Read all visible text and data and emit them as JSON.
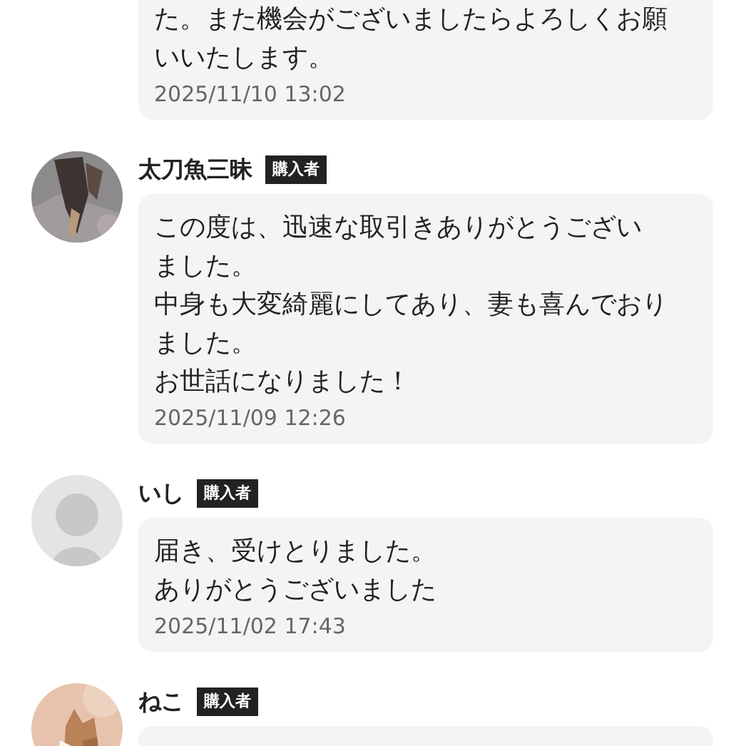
{
  "comments": [
    {
      "lines": [
        "た。また機会がございましたらよろしくお願",
        "いいたします。"
      ],
      "time": "2025/11/10 13:02"
    },
    {
      "name": "太刀魚三昧",
      "badge": "購入者",
      "lines": [
        "この度は、迅速な取引きありがとうござい",
        "ました。",
        "中身も大変綺麗にしてあり、妻も喜んでおり",
        "ました。",
        "お世話になりました！"
      ],
      "time": "2025/11/09 12:26"
    },
    {
      "avatar": {
        "kind": "default"
      },
      "name": "いし",
      "badge": "購入者",
      "lines": [
        "届き、受けとりました。",
        "ありがとうございました"
      ],
      "time": "2025/11/02 17:43"
    },
    {
      "name": "ねこ",
      "badge": "購入者"
    }
  ]
}
